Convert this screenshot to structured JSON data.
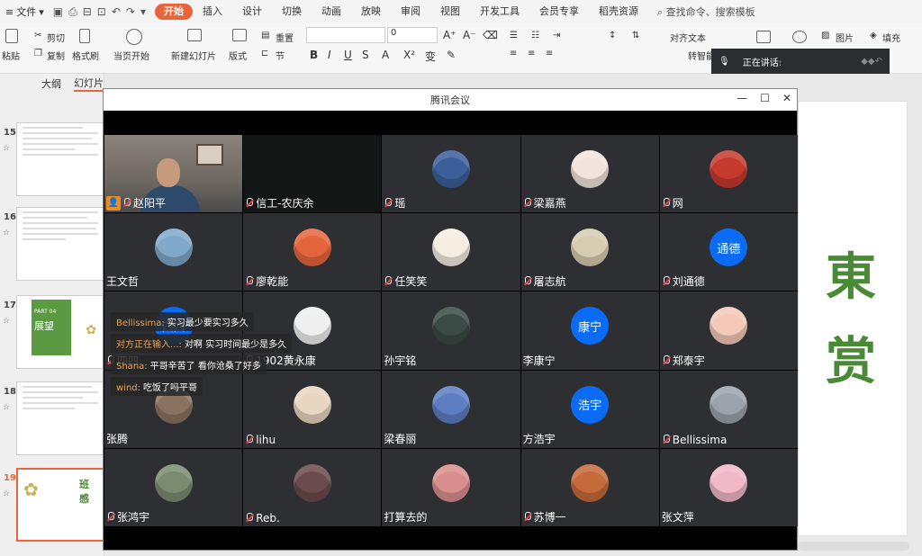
{
  "menubar": {
    "file_label": "文件",
    "tabs": [
      {
        "label": "开始",
        "active": true
      },
      {
        "label": "插入"
      },
      {
        "label": "设计"
      },
      {
        "label": "切换"
      },
      {
        "label": "动画"
      },
      {
        "label": "放映"
      },
      {
        "label": "审阅"
      },
      {
        "label": "视图"
      },
      {
        "label": "开发工具"
      },
      {
        "label": "会员专享"
      },
      {
        "label": "稻壳资源"
      }
    ],
    "search_label": "查找命令、搜索模板"
  },
  "ribbon": {
    "paste": "粘贴",
    "cut": "剪切",
    "copy": "复制",
    "format_painter": "格式刷",
    "from_current": "当页开始",
    "new_slide": "新建幻灯片",
    "layout": "版式",
    "reset": "重置",
    "section": "节",
    "font_size": "0",
    "align_text": "对齐文本",
    "picture": "图片",
    "fill": "填充",
    "smart_convert": "转智能",
    "speaking_label": "正在讲话:"
  },
  "sidepane": {
    "tab_outline": "大纲",
    "tab_slides": "幻灯片",
    "slides": [
      {
        "num": "15"
      },
      {
        "num": "16"
      },
      {
        "num": "17",
        "title": "PART 04",
        "subtitle": "展望"
      },
      {
        "num": "18"
      },
      {
        "num": "19",
        "current": true,
        "text_a": "班",
        "text_b": "感"
      }
    ]
  },
  "canvas": {
    "char_1": "東",
    "char_2": "赏"
  },
  "meeting": {
    "window_title": "腾讯会议",
    "participants": [
      {
        "name": "赵阳平",
        "type": "camera",
        "host": true
      },
      {
        "name": "信工-农庆余",
        "type": "camera-dark",
        "muted": true
      },
      {
        "name": "瑶",
        "muted": true,
        "avatar_color": "#3b5f9a"
      },
      {
        "name": "梁嘉燕",
        "muted": true,
        "avatar_color": "#f2e4dc"
      },
      {
        "name": "网",
        "muted": true,
        "avatar_color": "#c63a2e"
      },
      {
        "name": "王文哲",
        "avatar_color": "#7fa8c9"
      },
      {
        "name": "廖乾能",
        "muted": true,
        "avatar_color": "#e4643b"
      },
      {
        "name": "任笑笑",
        "muted": true,
        "avatar_color": "#f5ede2"
      },
      {
        "name": "屠志航",
        "muted": true,
        "avatar_color": "#d8cbb0"
      },
      {
        "name": "刘通德",
        "muted": true,
        "avatar_text": "通德"
      },
      {
        "name": "四四",
        "muted": true,
        "avatar_text": "四四"
      },
      {
        "name": "1902黄永康",
        "muted": true,
        "avatar_color": "#efefef"
      },
      {
        "name": "孙宇铭",
        "avatar_color": "#3a4a44"
      },
      {
        "name": "李康宁",
        "avatar_text": "康宁"
      },
      {
        "name": "郑泰宇",
        "muted": true,
        "avatar_color": "#f3c9b8"
      },
      {
        "name": "张腾",
        "avatar_color": "#8a7260"
      },
      {
        "name": "lihu",
        "muted": true,
        "avatar_color": "#e8d6c0"
      },
      {
        "name": "梁春丽",
        "avatar_color": "#5d7ec0"
      },
      {
        "name": "方浩宇",
        "avatar_text": "浩宇"
      },
      {
        "name": "Bellissima",
        "muted": true,
        "avatar_color": "#9aa3ab"
      },
      {
        "name": "张鸿宇",
        "muted": true,
        "avatar_color": "#7a8b6f"
      },
      {
        "name": "Reb.",
        "muted": true,
        "avatar_color": "#6b4b4b"
      },
      {
        "name": "打算去的",
        "avatar_color": "#d98e8e"
      },
      {
        "name": "苏博一",
        "muted": true,
        "avatar_color": "#c56a3a"
      },
      {
        "name": "张文萍",
        "avatar_color": "#f0b8c8"
      }
    ],
    "chat": [
      {
        "who": "Bellissima:",
        "text": "实习最少要实习多久"
      },
      {
        "who": "对方正在输入...:",
        "text": "对啊 实习时间最少是多久"
      },
      {
        "who": "Shana:",
        "text": "平哥辛苦了 看你沧桑了好多"
      },
      {
        "who": "wind:",
        "text": "吃饭了吗平哥"
      }
    ]
  }
}
